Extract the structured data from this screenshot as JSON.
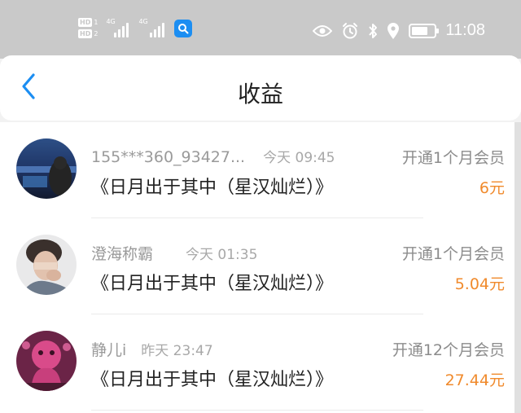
{
  "status_bar": {
    "hd1": "HD",
    "hd1_num": "1",
    "hd2": "HD",
    "hd2_num": "2",
    "net1": "4G",
    "net2": "4G",
    "time": "11:08",
    "battery_level": 0.7,
    "icons": [
      "eye-icon",
      "alarm-icon",
      "bluetooth-icon",
      "location-icon",
      "battery-icon"
    ]
  },
  "header": {
    "title": "收益",
    "back_icon": "chevron-left-icon",
    "accent": "#1c8ef2"
  },
  "items": [
    {
      "username": "155***360_93427...",
      "time": "今天 09:45",
      "book": "《日月出于其中（星汉灿烂）》",
      "desc": "开通1个月会员",
      "amount": "6元"
    },
    {
      "username": "澄海称霸",
      "time": "今天 01:35",
      "book": "《日月出于其中（星汉灿烂）》",
      "desc": "开通1个月会员",
      "amount": "5.04元"
    },
    {
      "username": "静儿i",
      "time": "昨天 23:47",
      "book": "《日月出于其中（星汉灿烂）》",
      "desc": "开通12个月会员",
      "amount": "27.44元"
    }
  ],
  "colors": {
    "amount": "#f08a2c",
    "title": "#222222",
    "muted": "#9a9a9a"
  }
}
